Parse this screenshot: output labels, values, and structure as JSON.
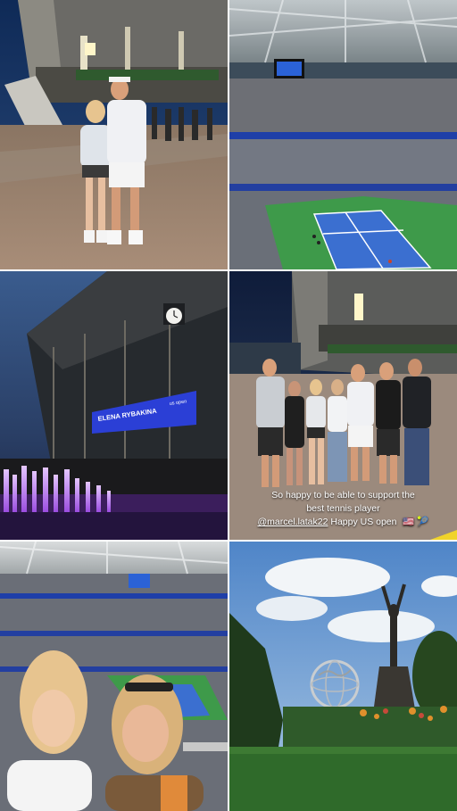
{
  "collage": {
    "tiles": [
      {
        "id": "exterior-photo"
      },
      {
        "id": "stadium-court-photo"
      },
      {
        "id": "arena-dusk-photo"
      },
      {
        "id": "group-photo"
      },
      {
        "id": "selfie-photo"
      },
      {
        "id": "unisphere-photo"
      }
    ]
  },
  "arena_screen": {
    "player_name": "ELENA RYBAKINA",
    "brand": "us open"
  },
  "story_caption": {
    "line1": "So happy to be able to support the",
    "line2": "best tennis player",
    "line3_mention": "@marcel.latak22",
    "line3_text": " Happy US open",
    "emojis": "🇺🇸 🎾"
  },
  "colors": {
    "court_blue": "#3b6fd0",
    "court_green": "#3e9a4a",
    "screen_blue": "#2b3fd6",
    "fountain_violet": "#9b4de0",
    "night_sky": "#0f1c3a"
  }
}
